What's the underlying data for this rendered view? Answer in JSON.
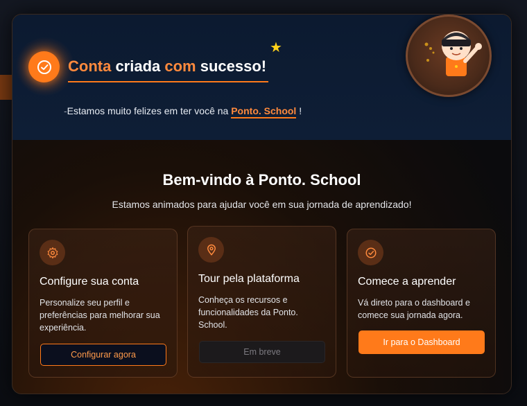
{
  "header": {
    "title_part1": "Conta",
    "title_part2": " criada ",
    "title_part3": "com",
    "title_part4": " sucesso!",
    "subtitle_pre": "Estamos muito felizes em ter você na ",
    "subtitle_brand": "Ponto. School",
    "subtitle_post": " !"
  },
  "welcome": {
    "title": "Bem-vindo à Ponto. School",
    "subtitle": "Estamos animados para ajudar você em sua jornada de aprendizado!"
  },
  "cards": [
    {
      "icon": "gear-icon",
      "title": "Configure sua conta",
      "text": "Personalize seu perfil e preferências para melhorar sua experiência.",
      "button": "Configurar agora"
    },
    {
      "icon": "map-pin-icon",
      "title": "Tour pela plataforma",
      "text": "Conheça os recursos e funcionalidades da Ponto. School.",
      "button": "Em breve"
    },
    {
      "icon": "check-circle-icon",
      "title": "Comece a aprender",
      "text": "Vá direto para o dashboard e comece sua jornada agora.",
      "button": "Ir para o Dashboard"
    }
  ],
  "colors": {
    "accent": "#ff7a1a",
    "header_bg": "#0e1e36",
    "star": "#ffd21a"
  }
}
